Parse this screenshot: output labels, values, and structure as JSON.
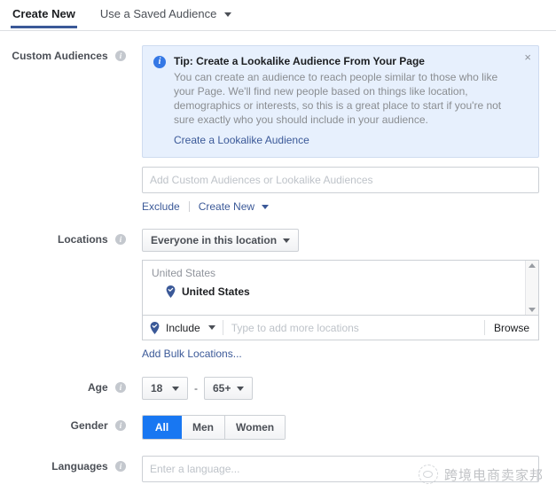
{
  "tabs": [
    {
      "label": "Create New",
      "active": true,
      "has_caret": false
    },
    {
      "label": "Use a Saved Audience",
      "active": false,
      "has_caret": true
    }
  ],
  "custom_audiences": {
    "label": "Custom Audiences",
    "tip": {
      "icon": "info-icon",
      "title": "Tip: Create a Lookalike Audience From Your Page",
      "body": "You can create an audience to reach people similar to those who like your Page. We'll find new people based on things like location, demographics or interests, so this is a great place to start if you're not sure exactly who you should include in your audience.",
      "link": "Create a Lookalike Audience",
      "close": "×"
    },
    "input_placeholder": "Add Custom Audiences or Lookalike Audiences",
    "exclude_link": "Exclude",
    "create_new_link": "Create New"
  },
  "locations": {
    "label": "Locations",
    "scope_button": "Everyone in this location",
    "group_header": "United States",
    "selected_items": [
      {
        "name": "United States",
        "icon": "location-pin-check-icon"
      }
    ],
    "include_mode": "Include",
    "typeahead_placeholder": "Type to add more locations",
    "browse_button": "Browse",
    "bulk_link": "Add Bulk Locations..."
  },
  "age": {
    "label": "Age",
    "min": "18",
    "max": "65+",
    "separator": "-"
  },
  "gender": {
    "label": "Gender",
    "options": [
      {
        "label": "All",
        "active": true
      },
      {
        "label": "Men",
        "active": false
      },
      {
        "label": "Women",
        "active": false
      }
    ]
  },
  "languages": {
    "label": "Languages",
    "placeholder": "Enter a language..."
  },
  "watermark": {
    "text": "跨境电商卖家邦"
  },
  "colors": {
    "tab_underline": "#3b5998",
    "link": "#3b5998",
    "accent_blue": "#1877f2",
    "tip_bg": "#e7f0fd",
    "tip_icon": "#3578e5",
    "border": "#ccd0d5",
    "placeholder": "#bec3c9",
    "label": "#4b4f56"
  }
}
